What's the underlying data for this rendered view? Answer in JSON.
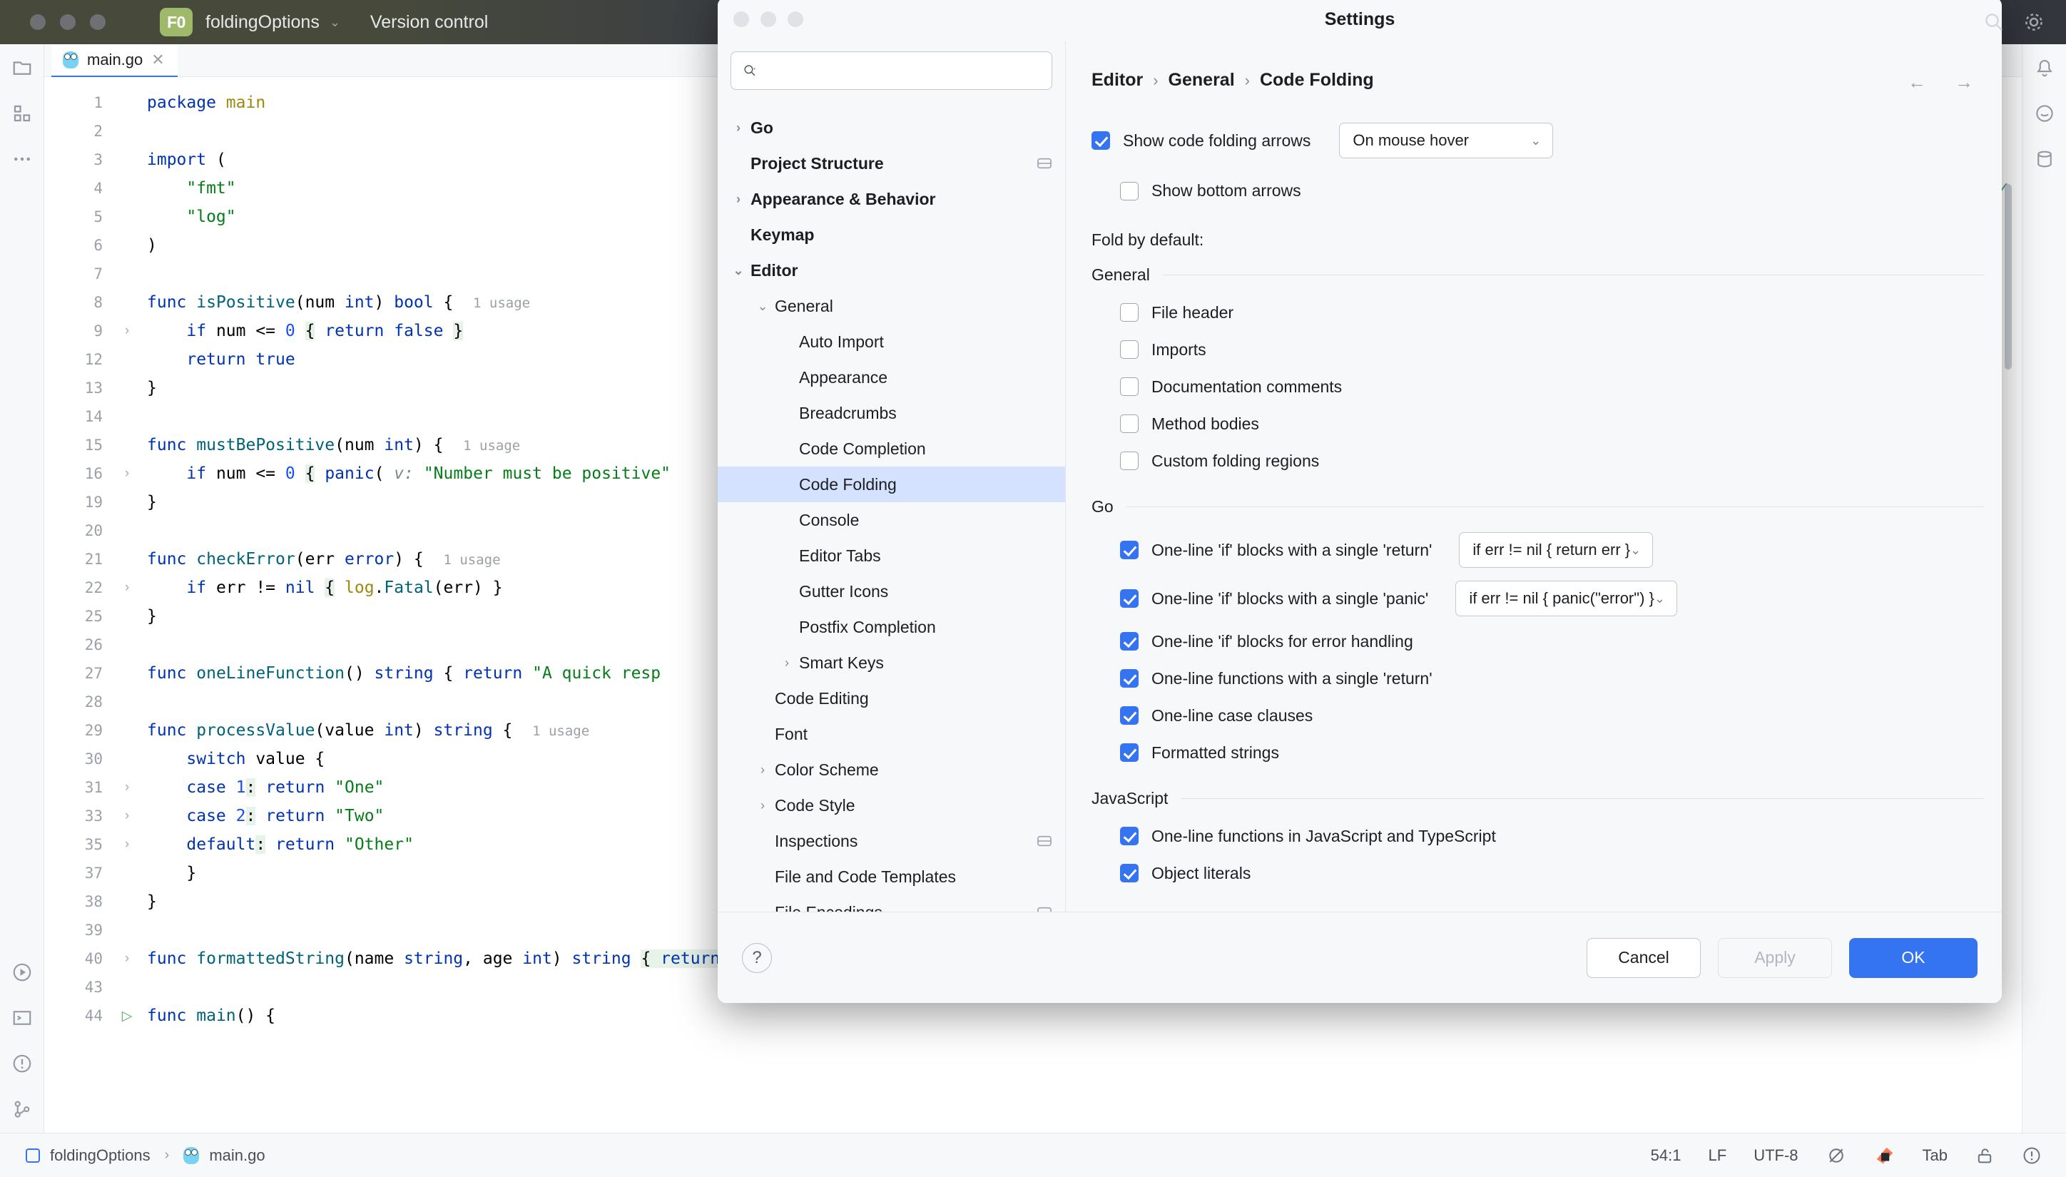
{
  "titlebar": {
    "project_badge": "F0",
    "project_name": "foldingOptions",
    "vcs_label": "Version control",
    "chevron": "⌄"
  },
  "editor_tab": {
    "filename": "main.go",
    "close": "✕"
  },
  "code": {
    "lines": [
      {
        "num": "1",
        "arrow": "",
        "html": "<span class='k'>package</span> <span class='pkg'>main</span>"
      },
      {
        "num": "2",
        "arrow": "",
        "html": ""
      },
      {
        "num": "3",
        "arrow": "",
        "html": "<span class='k'>import</span> ("
      },
      {
        "num": "4",
        "arrow": "",
        "html": "    <span class='st'>\"fmt\"</span>"
      },
      {
        "num": "5",
        "arrow": "",
        "html": "    <span class='st'>\"log\"</span>"
      },
      {
        "num": "6",
        "arrow": "",
        "html": ")"
      },
      {
        "num": "7",
        "arrow": "",
        "html": ""
      },
      {
        "num": "8",
        "arrow": "",
        "html": "<span class='k'>func</span> <span class='fn'>isPositive</span>(num <span class='ty'>int</span>) <span class='ty'>bool</span> {  <span class='usage'>1 usage</span>"
      },
      {
        "num": "9",
        "arrow": "›",
        "html": "    <span class='k'>if</span> num &lt;= <span class='nm'>0</span> <span class='fold-hl'>{</span> <span class='k'>return</span> <span class='k'>false</span> <span class='fold-hl'>}</span>"
      },
      {
        "num": "12",
        "arrow": "",
        "html": "    <span class='k'>return</span> <span class='k'>true</span>"
      },
      {
        "num": "13",
        "arrow": "",
        "html": "}"
      },
      {
        "num": "14",
        "arrow": "",
        "html": ""
      },
      {
        "num": "15",
        "arrow": "",
        "html": "<span class='k'>func</span> <span class='fn'>mustBePositive</span>(num <span class='ty'>int</span>) {  <span class='usage'>1 usage</span>"
      },
      {
        "num": "16",
        "arrow": "›",
        "html": "    <span class='k'>if</span> num &lt;= <span class='nm'>0</span> <span class='fold-hl'>{</span> <span class='k'>panic</span>( <span class='param-hint'>v:</span> <span class='st'>\"Number must be positive\"</span>"
      },
      {
        "num": "19",
        "arrow": "",
        "html": "}"
      },
      {
        "num": "20",
        "arrow": "",
        "html": ""
      },
      {
        "num": "21",
        "arrow": "",
        "html": "<span class='k'>func</span> <span class='fn'>checkError</span>(err <span class='ty'>error</span>) {  <span class='usage'>1 usage</span>"
      },
      {
        "num": "22",
        "arrow": "›",
        "html": "    <span class='k'>if</span> err != <span class='k'>nil</span> <span class='fold-hl'>{</span> <span class='pkg'>log</span>.<span class='fn'>Fatal</span>(err) }"
      },
      {
        "num": "25",
        "arrow": "",
        "html": "}"
      },
      {
        "num": "26",
        "arrow": "",
        "html": ""
      },
      {
        "num": "27",
        "arrow": "",
        "html": "<span class='k'>func</span> <span class='fn'>oneLineFunction</span>() <span class='ty'>string</span> { <span class='k'>return</span> <span class='st'>\"A quick resp</span>"
      },
      {
        "num": "28",
        "arrow": "",
        "html": ""
      },
      {
        "num": "29",
        "arrow": "",
        "html": "<span class='k'>func</span> <span class='fn'>processValue</span>(value <span class='ty'>int</span>) <span class='ty'>string</span> {  <span class='usage'>1 usage</span>"
      },
      {
        "num": "30",
        "arrow": "",
        "html": "    <span class='k'>switch</span> value {"
      },
      {
        "num": "31",
        "arrow": "›",
        "html": "    <span class='k'>case</span> <span class='nm'>1</span><span class='fold-hl'>:</span> <span class='k'>return</span> <span class='st'>\"One\"</span>"
      },
      {
        "num": "33",
        "arrow": "›",
        "html": "    <span class='k'>case</span> <span class='nm'>2</span><span class='fold-hl'>:</span> <span class='k'>return</span> <span class='st'>\"Two\"</span>"
      },
      {
        "num": "35",
        "arrow": "›",
        "html": "    <span class='k'>default</span><span class='fold-hl'>:</span> <span class='k'>return</span> <span class='st'>\"Other\"</span>"
      },
      {
        "num": "37",
        "arrow": "",
        "html": "    }"
      },
      {
        "num": "38",
        "arrow": "",
        "html": "}"
      },
      {
        "num": "39",
        "arrow": "",
        "html": ""
      },
      {
        "num": "40",
        "arrow": "›",
        "html": "<span class='k'>func</span> <span class='fn'>formattedString</span>(name <span class='ty'>string</span>, age <span class='ty'>int</span>) <span class='ty'>string</span> <span class='fold-hl'>{ <span class='k'>return</span> <span class='pkg'>fmt</span>.<span class='fn'>Sprintf</span>(<span class='st'>\"Name: #{name}, Age: #{age}\"</span>) }</span>"
      },
      {
        "num": "43",
        "arrow": "",
        "html": ""
      },
      {
        "num": "44",
        "arrow": "▷",
        "html": "<span class='k'>func</span> <span class='fn'>main</span>() {"
      }
    ]
  },
  "statusbar": {
    "project": "foldingOptions",
    "separator": "›",
    "file": "main.go",
    "caret": "54:1",
    "line_ending": "LF",
    "encoding": "UTF-8",
    "indent": "Tab"
  },
  "settings": {
    "window_title": "Settings",
    "search": {
      "value": "",
      "placeholder": ""
    },
    "tree": [
      {
        "label": "Go",
        "twisty": "›",
        "indent": 0,
        "bold": true,
        "selected": false,
        "badge": false
      },
      {
        "label": "Project Structure",
        "twisty": "",
        "indent": 0,
        "bold": true,
        "selected": false,
        "badge": true
      },
      {
        "label": "Appearance & Behavior",
        "twisty": "›",
        "indent": 0,
        "bold": true,
        "selected": false,
        "badge": false
      },
      {
        "label": "Keymap",
        "twisty": "",
        "indent": 0,
        "bold": true,
        "selected": false,
        "badge": false
      },
      {
        "label": "Editor",
        "twisty": "⌄",
        "indent": 0,
        "bold": true,
        "selected": false,
        "badge": false
      },
      {
        "label": "General",
        "twisty": "⌄",
        "indent": 1,
        "bold": false,
        "selected": false,
        "badge": false
      },
      {
        "label": "Auto Import",
        "twisty": "",
        "indent": 2,
        "bold": false,
        "selected": false,
        "badge": false
      },
      {
        "label": "Appearance",
        "twisty": "",
        "indent": 2,
        "bold": false,
        "selected": false,
        "badge": false
      },
      {
        "label": "Breadcrumbs",
        "twisty": "",
        "indent": 2,
        "bold": false,
        "selected": false,
        "badge": false
      },
      {
        "label": "Code Completion",
        "twisty": "",
        "indent": 2,
        "bold": false,
        "selected": false,
        "badge": false
      },
      {
        "label": "Code Folding",
        "twisty": "",
        "indent": 2,
        "bold": false,
        "selected": true,
        "badge": false
      },
      {
        "label": "Console",
        "twisty": "",
        "indent": 2,
        "bold": false,
        "selected": false,
        "badge": false
      },
      {
        "label": "Editor Tabs",
        "twisty": "",
        "indent": 2,
        "bold": false,
        "selected": false,
        "badge": false
      },
      {
        "label": "Gutter Icons",
        "twisty": "",
        "indent": 2,
        "bold": false,
        "selected": false,
        "badge": false
      },
      {
        "label": "Postfix Completion",
        "twisty": "",
        "indent": 2,
        "bold": false,
        "selected": false,
        "badge": false
      },
      {
        "label": "Smart Keys",
        "twisty": "›",
        "indent": 2,
        "bold": false,
        "selected": false,
        "badge": false
      },
      {
        "label": "Code Editing",
        "twisty": "",
        "indent": 1,
        "bold": false,
        "selected": false,
        "badge": false
      },
      {
        "label": "Font",
        "twisty": "",
        "indent": 1,
        "bold": false,
        "selected": false,
        "badge": false
      },
      {
        "label": "Color Scheme",
        "twisty": "›",
        "indent": 1,
        "bold": false,
        "selected": false,
        "badge": false
      },
      {
        "label": "Code Style",
        "twisty": "›",
        "indent": 1,
        "bold": false,
        "selected": false,
        "badge": false
      },
      {
        "label": "Inspections",
        "twisty": "",
        "indent": 1,
        "bold": false,
        "selected": false,
        "badge": true
      },
      {
        "label": "File and Code Templates",
        "twisty": "",
        "indent": 1,
        "bold": false,
        "selected": false,
        "badge": false
      },
      {
        "label": "File Encodings",
        "twisty": "",
        "indent": 1,
        "bold": false,
        "selected": false,
        "badge": true
      }
    ],
    "breadcrumb": {
      "l1": "Editor",
      "sep1": "›",
      "l2": "General",
      "sep2": "›",
      "l3": "Code Folding"
    },
    "show_folding_arrows": {
      "label": "Show code folding arrows",
      "checked": true,
      "combo_value": "On mouse hover"
    },
    "show_bottom_arrows": {
      "label": "Show bottom arrows",
      "checked": false
    },
    "fold_by_default_label": "Fold by default:",
    "groups": [
      {
        "title": "General",
        "items": [
          {
            "label": "File header",
            "checked": false,
            "combo": null
          },
          {
            "label": "Imports",
            "checked": false,
            "combo": null
          },
          {
            "label": "Documentation comments",
            "checked": false,
            "combo": null
          },
          {
            "label": "Method bodies",
            "checked": false,
            "combo": null
          },
          {
            "label": "Custom folding regions",
            "checked": false,
            "combo": null
          }
        ]
      },
      {
        "title": "Go",
        "items": [
          {
            "label": "One-line 'if' blocks with a single 'return'",
            "checked": true,
            "combo": "if err != nil { return err }"
          },
          {
            "label": "One-line 'if' blocks with a single 'panic'",
            "checked": true,
            "combo": "if err != nil { panic(\"error\") }"
          },
          {
            "label": "One-line 'if' blocks for error handling",
            "checked": true,
            "combo": null
          },
          {
            "label": "One-line functions with a single 'return'",
            "checked": true,
            "combo": null
          },
          {
            "label": "One-line case clauses",
            "checked": true,
            "combo": null
          },
          {
            "label": "Formatted strings",
            "checked": true,
            "combo": null
          }
        ]
      },
      {
        "title": "JavaScript",
        "items": [
          {
            "label": "One-line functions in JavaScript and TypeScript",
            "checked": true,
            "combo": null
          },
          {
            "label": "Object literals",
            "checked": true,
            "combo": null
          }
        ]
      }
    ],
    "footer": {
      "help": "?",
      "cancel": "Cancel",
      "apply": "Apply",
      "ok": "OK"
    },
    "nav_back": "←",
    "nav_forward": "→"
  },
  "colors": {
    "accent": "#3574f0",
    "selection": "#d4e2ff",
    "fold_highlight": "#e7f3e8",
    "titlebar": "#3c3f41",
    "badge_green": "#9fb96a"
  }
}
